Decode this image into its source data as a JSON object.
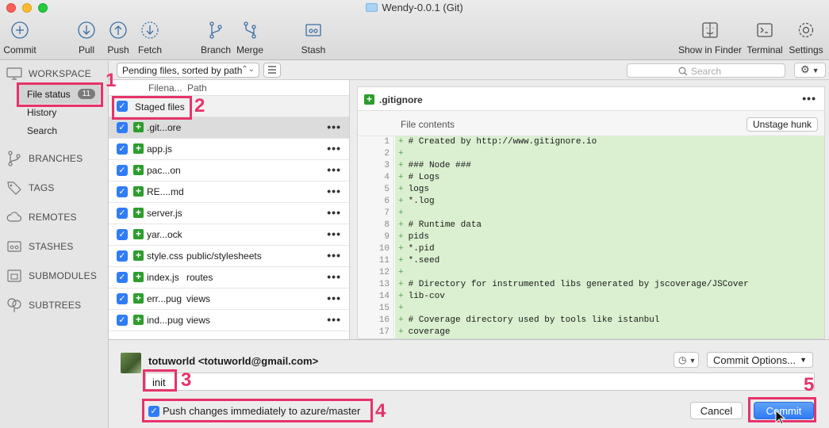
{
  "window": {
    "title": "Wendy-0.0.1 (Git)"
  },
  "toolbar": {
    "commit": "Commit",
    "pull": "Pull",
    "push": "Push",
    "fetch": "Fetch",
    "branch": "Branch",
    "merge": "Merge",
    "stash": "Stash",
    "show_in_finder": "Show in Finder",
    "terminal": "Terminal",
    "settings": "Settings"
  },
  "sidebar": {
    "workspace": "WORKSPACE",
    "file_status": "File status",
    "file_status_count": "11",
    "history": "History",
    "search": "Search",
    "branches": "BRANCHES",
    "tags": "TAGS",
    "remotes": "REMOTES",
    "stashes": "STASHES",
    "submodules": "SUBMODULES",
    "subtrees": "SUBTREES"
  },
  "filter": {
    "sort_select": "Pending files, sorted by path",
    "search_placeholder": "Search"
  },
  "filelist": {
    "col_filename": "Filena...",
    "col_path": "Path",
    "staged_header": "Staged files",
    "files": [
      {
        "name": ".git...ore",
        "path": ""
      },
      {
        "name": "app.js",
        "path": ""
      },
      {
        "name": "pac...on",
        "path": ""
      },
      {
        "name": "RE....md",
        "path": ""
      },
      {
        "name": "server.js",
        "path": ""
      },
      {
        "name": "yar...ock",
        "path": ""
      },
      {
        "name": "style.css",
        "path": "public/stylesheets"
      },
      {
        "name": "index.js",
        "path": "routes"
      },
      {
        "name": "err...pug",
        "path": "views"
      },
      {
        "name": "ind...pug",
        "path": "views"
      }
    ]
  },
  "diff": {
    "filename": ".gitignore",
    "hunk_label": "File contents",
    "unstage_label": "Unstage hunk",
    "lines": [
      {
        "n": "1",
        "text": "# Created by http://www.gitignore.io"
      },
      {
        "n": "2",
        "text": ""
      },
      {
        "n": "3",
        "text": "### Node ###"
      },
      {
        "n": "4",
        "text": "# Logs"
      },
      {
        "n": "5",
        "text": "logs"
      },
      {
        "n": "6",
        "text": "*.log"
      },
      {
        "n": "7",
        "text": ""
      },
      {
        "n": "8",
        "text": "# Runtime data"
      },
      {
        "n": "9",
        "text": "pids"
      },
      {
        "n": "10",
        "text": "*.pid"
      },
      {
        "n": "11",
        "text": "*.seed"
      },
      {
        "n": "12",
        "text": ""
      },
      {
        "n": "13",
        "text": "# Directory for instrumented libs generated by jscoverage/JSCover"
      },
      {
        "n": "14",
        "text": "lib-cov"
      },
      {
        "n": "15",
        "text": ""
      },
      {
        "n": "16",
        "text": "# Coverage directory used by tools like istanbul"
      },
      {
        "n": "17",
        "text": "coverage"
      }
    ]
  },
  "commit": {
    "author": "totuworld <totuworld@gmail.com>",
    "options": "Commit Options...",
    "message": "init",
    "push_option": "Push changes immediately to azure/master",
    "cancel": "Cancel",
    "commit": "Commit"
  },
  "annotations": [
    "1",
    "2",
    "3",
    "4",
    "5"
  ],
  "colors": {
    "accent": "#2f7cf6",
    "annotation": "#e6336a",
    "added": "#2e9d2e",
    "added_bg": "#daf0d0"
  }
}
